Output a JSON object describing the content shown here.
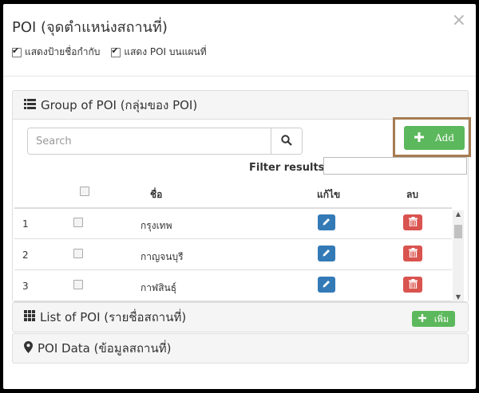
{
  "modal": {
    "title": "POI (จุดตำแหน่งสถานที่)",
    "close_glyph": "×",
    "options": [
      {
        "label": "แสดงป้ายชื่อกำกับ",
        "checked": true
      },
      {
        "label": "แสดง POI บนแผนที่",
        "checked": true
      }
    ]
  },
  "group_panel": {
    "title": "Group of POI (กลุ่มของ POI)",
    "icon": "list-icon",
    "search_placeholder": "Search",
    "add_label": "Add",
    "filter_label": "Filter results:",
    "filter_value": "",
    "columns": {
      "check": "",
      "name": "ชื่อ",
      "edit": "แก้ไข",
      "delete": "ลบ"
    },
    "rows": [
      {
        "num": "1",
        "name": "กรุงเทพ"
      },
      {
        "num": "2",
        "name": "กาญจนบุรี"
      },
      {
        "num": "3",
        "name": "กาฬสินธุ์"
      }
    ]
  },
  "list_panel": {
    "title": "List of POI (รายชื่อสถานที่)",
    "icon": "grid-icon",
    "add_label": "เพิ่ม"
  },
  "data_panel": {
    "title": "POI Data (ข้อมูลสถานที่)",
    "icon": "map-marker-icon"
  },
  "colors": {
    "green": "#5cb85c",
    "blue": "#337ab7",
    "red": "#d9534f",
    "highlight": "#a67c52"
  }
}
